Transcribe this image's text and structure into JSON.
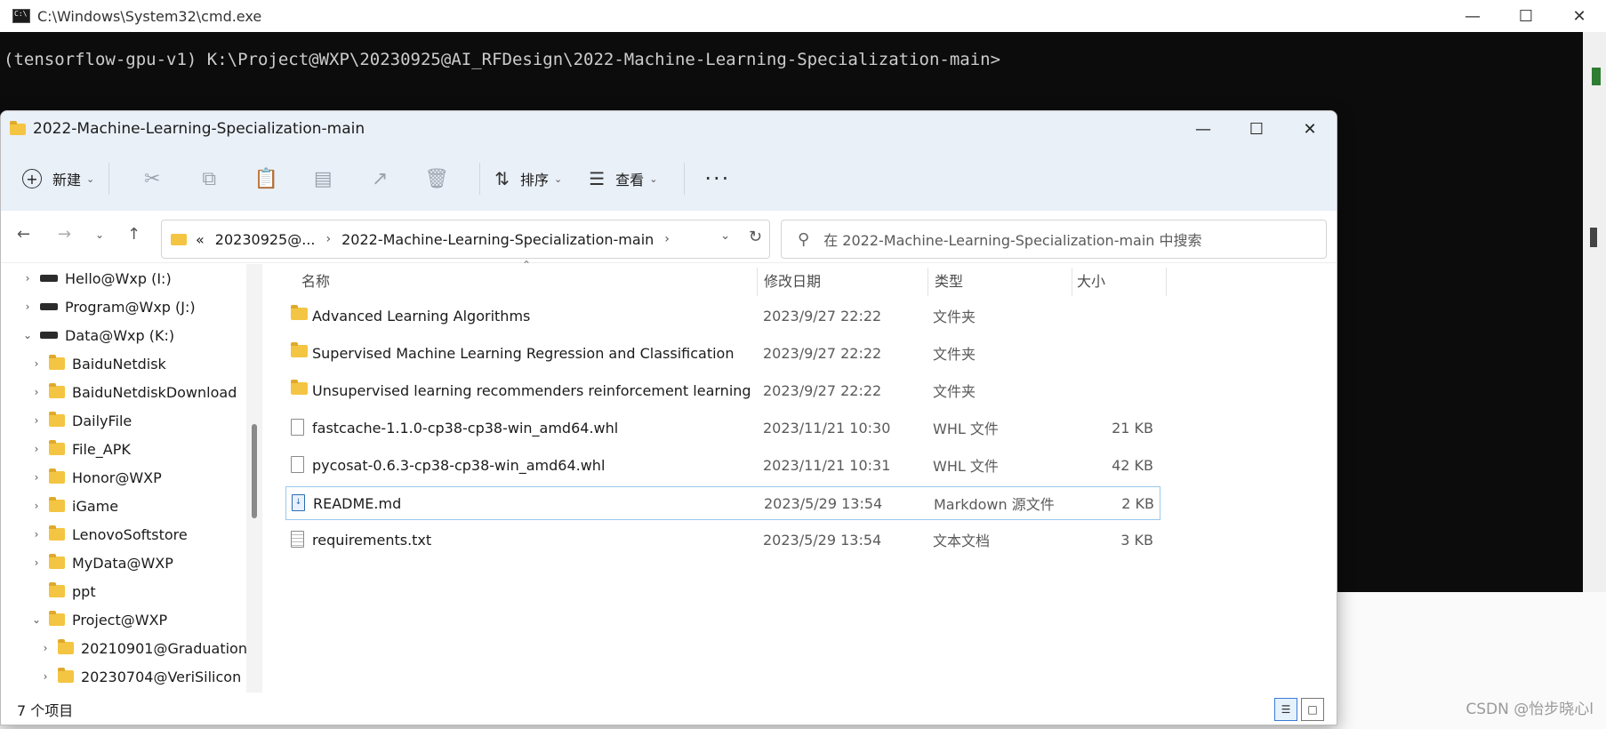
{
  "cmd": {
    "title": "C:\\Windows\\System32\\cmd.exe",
    "prompt_line": "(tensorflow-gpu-v1) K:\\Project@WXP\\20230925@AI_RFDesign\\2022-Machine-Learning-Specialization-main>"
  },
  "explorer": {
    "title": "2022-Machine-Learning-Specialization-main",
    "toolbar": {
      "new_label": "新建",
      "sort_label": "排序",
      "view_label": "查看",
      "more_label": "···"
    },
    "address": {
      "prefix": "«",
      "crumbs": [
        "20230925@...",
        "2022-Machine-Learning-Specialization-main"
      ]
    },
    "search": {
      "placeholder": "在 2022-Machine-Learning-Specialization-main 中搜索"
    },
    "nav_tree": [
      {
        "label": "Hello@Wxp (I:)"
      },
      {
        "label": "Program@Wxp (J:)"
      },
      {
        "label": "Data@Wxp (K:)"
      },
      {
        "label": "BaiduNetdisk"
      },
      {
        "label": "BaiduNetdiskDownload"
      },
      {
        "label": "DailyFile"
      },
      {
        "label": "File_APK"
      },
      {
        "label": "Honor@WXP"
      },
      {
        "label": "iGame"
      },
      {
        "label": "LenovoSoftstore"
      },
      {
        "label": "MyData@WXP"
      },
      {
        "label": "ppt"
      },
      {
        "label": "Project@WXP"
      },
      {
        "label": "20210901@Graduation"
      },
      {
        "label": "20230704@VeriSilicon"
      }
    ],
    "columns": {
      "name": "名称",
      "date": "修改日期",
      "type": "类型",
      "size": "大小"
    },
    "files": [
      {
        "name": "Advanced Learning Algorithms",
        "date": "2023/9/27 22:22",
        "type": "文件夹",
        "size": "",
        "icon": "folder-icon"
      },
      {
        "name": "Supervised Machine Learning Regression and Classification",
        "date": "2023/9/27 22:22",
        "type": "文件夹",
        "size": "",
        "icon": "folder-icon"
      },
      {
        "name": "Unsupervised learning recommenders reinforcement learning",
        "date": "2023/9/27 22:22",
        "type": "文件夹",
        "size": "",
        "icon": "folder-icon"
      },
      {
        "name": "fastcache-1.1.0-cp38-cp38-win_amd64.whl",
        "date": "2023/11/21 10:30",
        "type": "WHL 文件",
        "size": "21 KB",
        "icon": "file-icon"
      },
      {
        "name": "pycosat-0.6.3-cp38-cp38-win_amd64.whl",
        "date": "2023/11/21 10:31",
        "type": "WHL 文件",
        "size": "42 KB",
        "icon": "file-icon"
      },
      {
        "name": "README.md",
        "date": "2023/5/29 13:54",
        "type": "Markdown 源文件",
        "size": "2 KB",
        "icon": "markdown-file-icon"
      },
      {
        "name": "requirements.txt",
        "date": "2023/5/29 13:54",
        "type": "文本文档",
        "size": "3 KB",
        "icon": "text-file-icon"
      }
    ],
    "status": "7 个项目"
  },
  "watermark": "CSDN @怡步晓心l"
}
